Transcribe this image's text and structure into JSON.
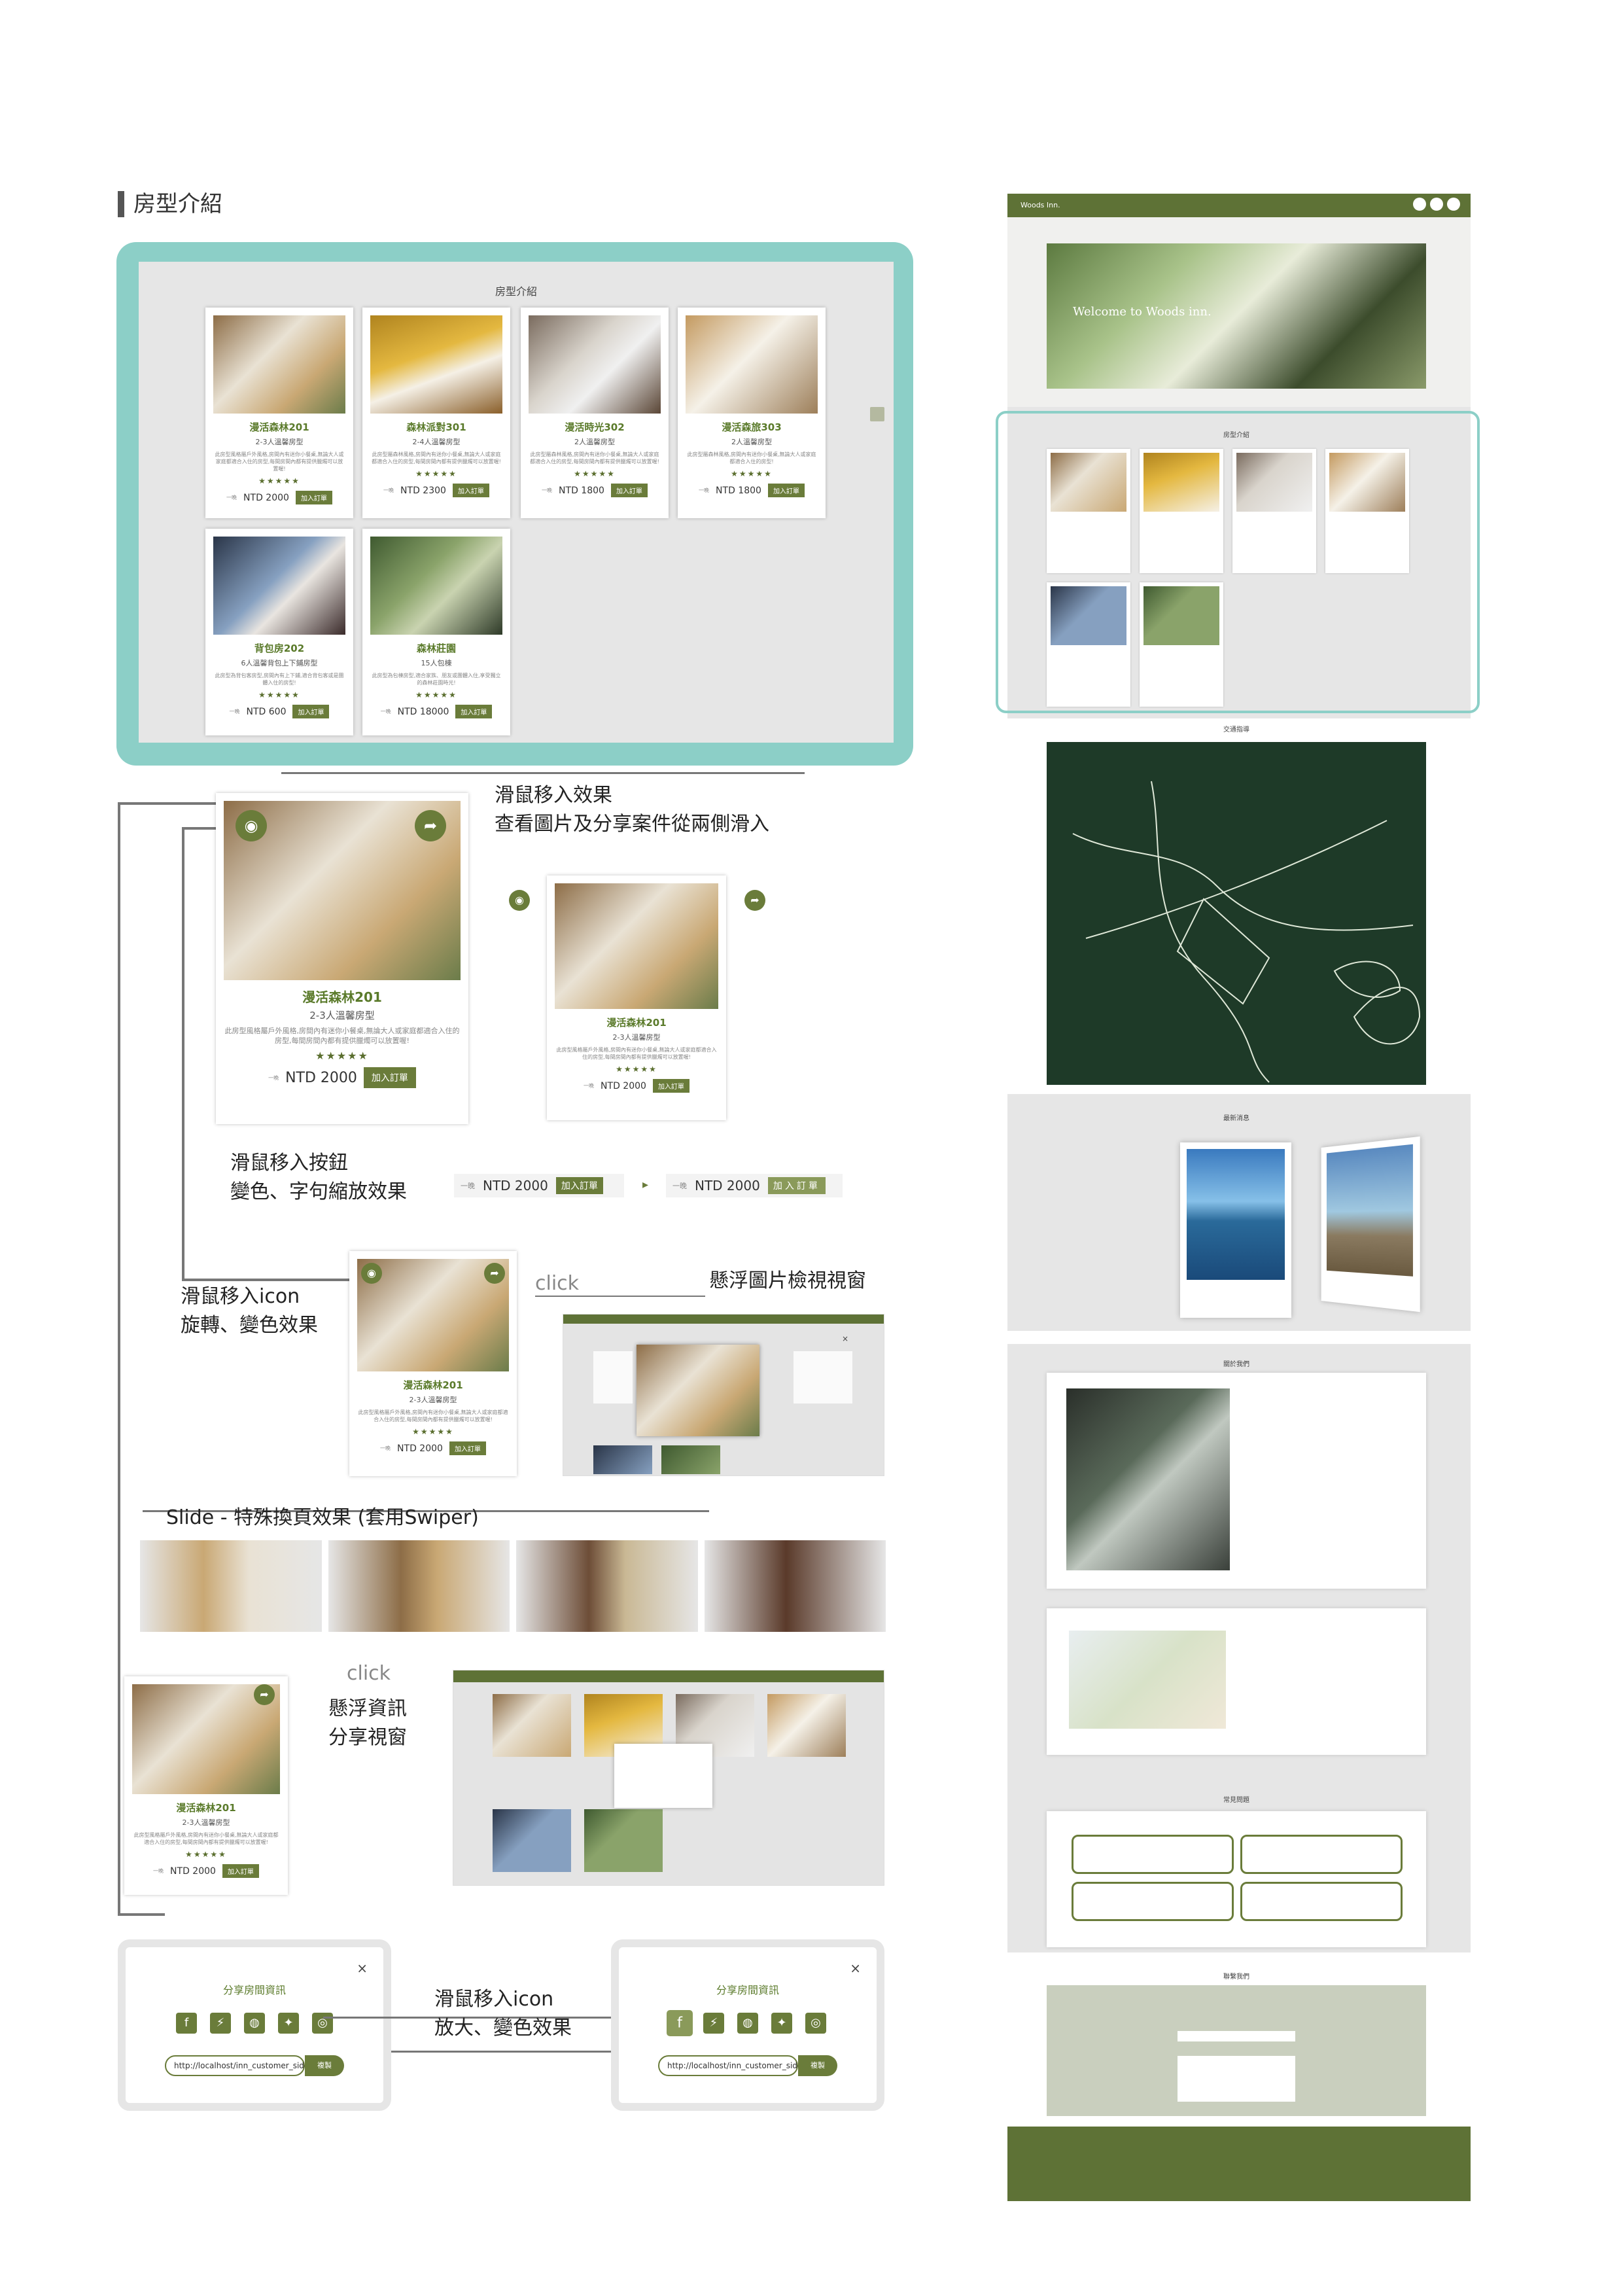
{
  "heading": "房型介紹",
  "section_title": "房型介紹",
  "rooms": [
    {
      "name": "漫活森林201",
      "capacity": "2-3人溫馨房型",
      "desc": "此房型風格屬戶外風格,房間內有迷你小餐桌,無論大人或家庭都適合入住的房型,每間房間內都有提供臘燭可以放置喔!",
      "stars": "★★★★★",
      "price_prefix": "一晚",
      "price": "NTD 2000",
      "button": "加入訂單"
    },
    {
      "name": "森林派對301",
      "capacity": "2-4人溫馨房型",
      "desc": "此房型屬森林風格,房間內有迷你小餐桌,無論大人或家庭都適合入住的房型,每間房間內都有提供臘燭可以放置喔!",
      "stars": "★★★★★",
      "price_prefix": "一晚",
      "price": "NTD 2300",
      "button": "加入訂單"
    },
    {
      "name": "漫活時光302",
      "capacity": "2人溫馨房型",
      "desc": "此房型屬森林風格,房間內有迷你小餐桌,無論大人或家庭都適合入住的房型,每間房間內都有提供臘燭可以放置喔!",
      "stars": "★★★★★",
      "price_prefix": "一晚",
      "price": "NTD 1800",
      "button": "加入訂單"
    },
    {
      "name": "漫活森旅303",
      "capacity": "2人溫馨房型",
      "desc": "此房型屬森林風格,房間內有迷你小餐桌,無論大人或家庭都適合入住的房型!",
      "stars": "★★★★★",
      "price_prefix": "一晚",
      "price": "NTD 1800",
      "button": "加入訂單"
    },
    {
      "name": "背包房202",
      "capacity": "6人溫馨背包上下鋪房型",
      "desc": "此房型為背包客房型,房間內有上下鋪,適合背包客或是團體入住的房型!",
      "stars": "★★★★★",
      "price_prefix": "一晚",
      "price": "NTD 600",
      "button": "加入訂單"
    },
    {
      "name": "森林莊園",
      "capacity": "15人包棟",
      "desc": "此房型為包棟房型,適合家族、朋友或團體入住,享受獨立的森林莊園時光!",
      "stars": "★★★★★",
      "price_prefix": "一晚",
      "price": "NTD 18000",
      "button": "加入訂單"
    }
  ],
  "annotations": {
    "hover_effect": "滑鼠移入效果\n查看圖片及分享案件從兩側滑入",
    "hover_button": "滑鼠移入按鈕\n變色、字句縮放效果",
    "hover_icon": "滑鼠移入icon\n旋轉、變色效果",
    "click_1": "click",
    "image_viewer": "懸浮圖片檢視視窗",
    "slide": "Slide - 特殊換頁效果 (套用Swiper)",
    "click_2": "click",
    "share_window": "懸浮資訊\n分享視窗",
    "hover_icon_zoom": "滑鼠移入icon\n放大、變色效果"
  },
  "share": {
    "title_left": "分享房間資訊",
    "title_right": "分享房間資訊",
    "url": "http://localhost/inn_customer_side/inn_i",
    "button": "複製",
    "close": "×"
  },
  "site": {
    "brand": "Woods Inn.",
    "hero_text": "Welcome to Woods inn.",
    "room_section": "房型介紹",
    "traffic_section": "交通指導",
    "news_section": "最新消息",
    "about_section": "關於我們",
    "faq_section": "常見問題",
    "contact_section": "聯繫我們"
  },
  "colors": {
    "accent": "#6a7c3a",
    "teal": "#8ccfc7",
    "nav": "#5e7236"
  },
  "icons": [
    "eye-icon",
    "share-icon",
    "facebook-icon",
    "messenger-icon",
    "line-icon",
    "twitter-icon",
    "instagram-icon",
    "close-icon"
  ]
}
